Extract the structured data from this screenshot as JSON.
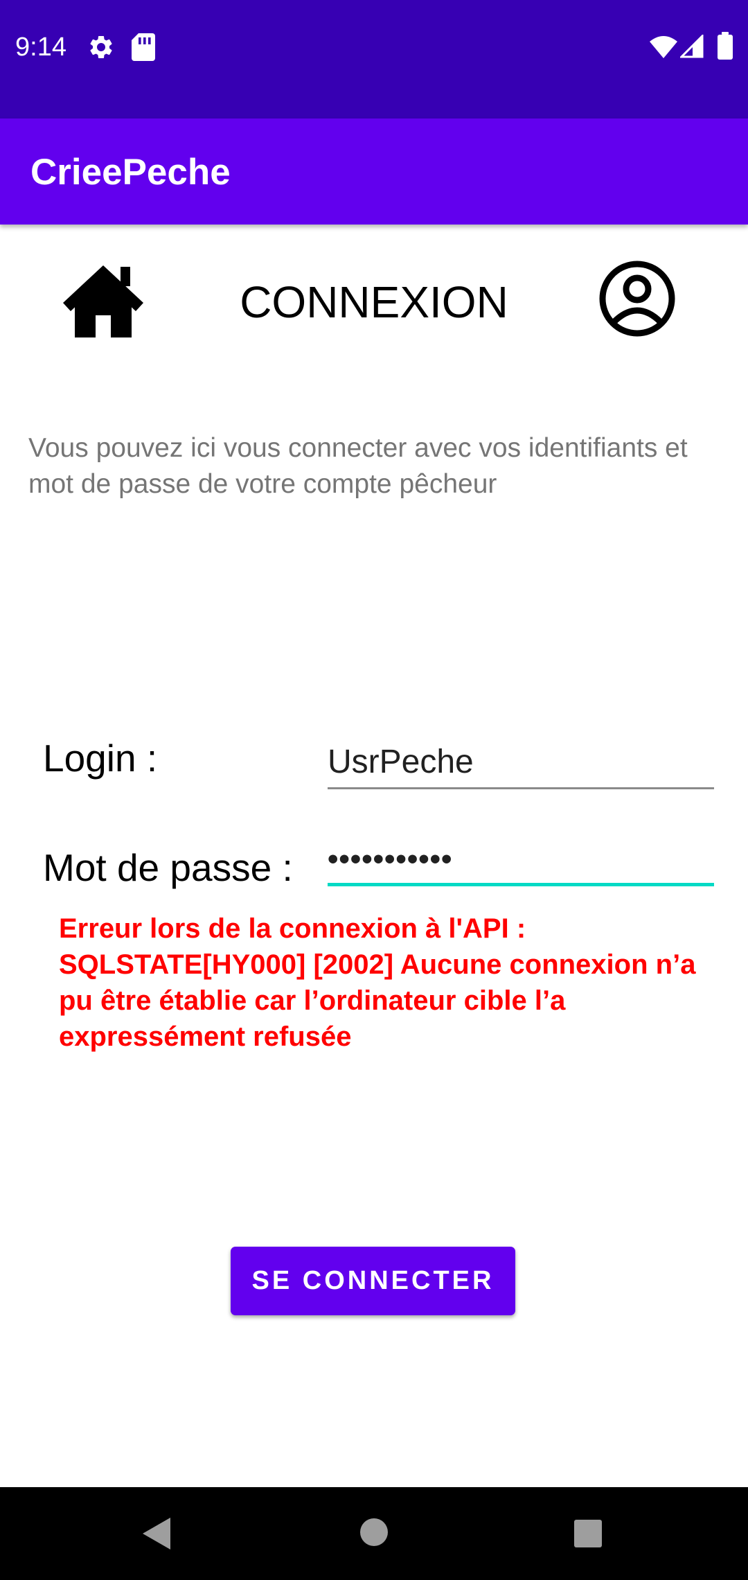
{
  "status_bar": {
    "time": "9:14",
    "icons": [
      "gear-icon",
      "sd-card-icon",
      "wifi-icon",
      "signal-icon",
      "battery-icon"
    ]
  },
  "app_bar": {
    "title": "CrieePeche"
  },
  "header": {
    "home_icon": "home-icon",
    "title": "CONNEXION",
    "account_icon": "account-circle-icon"
  },
  "intro": {
    "text": "Vous pouvez ici vous connecter avec vos identifiants et mot de passe de votre compte pêcheur"
  },
  "form": {
    "login_label": "Login :",
    "login_value": "UsrPeche",
    "password_label": "Mot de passe :",
    "password_value": "•••••••••••",
    "password_focused": true
  },
  "error": {
    "message": "Erreur lors de la connexion à l'API : SQLSTATE[HY000] [2002] Aucune connexion n’a pu être établie car l’ordinateur cible l’a expressément refusée"
  },
  "actions": {
    "connect_label": "SE CONNECTER"
  },
  "nav_bar": {
    "icons": [
      "back-icon",
      "home-nav-icon",
      "recents-icon"
    ]
  },
  "colors": {
    "status_bar": "#3700b3",
    "app_bar": "#6200ee",
    "accent": "#03dac5",
    "error": "#ff0000",
    "intro_text": "#757575"
  }
}
